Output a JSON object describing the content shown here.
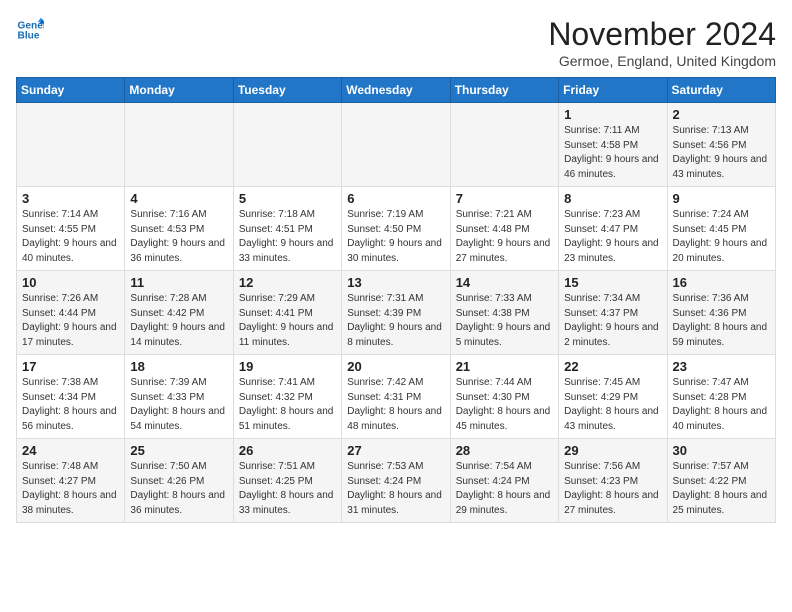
{
  "header": {
    "logo_line1": "General",
    "logo_line2": "Blue",
    "month_title": "November 2024",
    "location": "Germoe, England, United Kingdom"
  },
  "days_of_week": [
    "Sunday",
    "Monday",
    "Tuesday",
    "Wednesday",
    "Thursday",
    "Friday",
    "Saturday"
  ],
  "weeks": [
    [
      {
        "num": "",
        "info": ""
      },
      {
        "num": "",
        "info": ""
      },
      {
        "num": "",
        "info": ""
      },
      {
        "num": "",
        "info": ""
      },
      {
        "num": "",
        "info": ""
      },
      {
        "num": "1",
        "info": "Sunrise: 7:11 AM\nSunset: 4:58 PM\nDaylight: 9 hours and 46 minutes."
      },
      {
        "num": "2",
        "info": "Sunrise: 7:13 AM\nSunset: 4:56 PM\nDaylight: 9 hours and 43 minutes."
      }
    ],
    [
      {
        "num": "3",
        "info": "Sunrise: 7:14 AM\nSunset: 4:55 PM\nDaylight: 9 hours and 40 minutes."
      },
      {
        "num": "4",
        "info": "Sunrise: 7:16 AM\nSunset: 4:53 PM\nDaylight: 9 hours and 36 minutes."
      },
      {
        "num": "5",
        "info": "Sunrise: 7:18 AM\nSunset: 4:51 PM\nDaylight: 9 hours and 33 minutes."
      },
      {
        "num": "6",
        "info": "Sunrise: 7:19 AM\nSunset: 4:50 PM\nDaylight: 9 hours and 30 minutes."
      },
      {
        "num": "7",
        "info": "Sunrise: 7:21 AM\nSunset: 4:48 PM\nDaylight: 9 hours and 27 minutes."
      },
      {
        "num": "8",
        "info": "Sunrise: 7:23 AM\nSunset: 4:47 PM\nDaylight: 9 hours and 23 minutes."
      },
      {
        "num": "9",
        "info": "Sunrise: 7:24 AM\nSunset: 4:45 PM\nDaylight: 9 hours and 20 minutes."
      }
    ],
    [
      {
        "num": "10",
        "info": "Sunrise: 7:26 AM\nSunset: 4:44 PM\nDaylight: 9 hours and 17 minutes."
      },
      {
        "num": "11",
        "info": "Sunrise: 7:28 AM\nSunset: 4:42 PM\nDaylight: 9 hours and 14 minutes."
      },
      {
        "num": "12",
        "info": "Sunrise: 7:29 AM\nSunset: 4:41 PM\nDaylight: 9 hours and 11 minutes."
      },
      {
        "num": "13",
        "info": "Sunrise: 7:31 AM\nSunset: 4:39 PM\nDaylight: 9 hours and 8 minutes."
      },
      {
        "num": "14",
        "info": "Sunrise: 7:33 AM\nSunset: 4:38 PM\nDaylight: 9 hours and 5 minutes."
      },
      {
        "num": "15",
        "info": "Sunrise: 7:34 AM\nSunset: 4:37 PM\nDaylight: 9 hours and 2 minutes."
      },
      {
        "num": "16",
        "info": "Sunrise: 7:36 AM\nSunset: 4:36 PM\nDaylight: 8 hours and 59 minutes."
      }
    ],
    [
      {
        "num": "17",
        "info": "Sunrise: 7:38 AM\nSunset: 4:34 PM\nDaylight: 8 hours and 56 minutes."
      },
      {
        "num": "18",
        "info": "Sunrise: 7:39 AM\nSunset: 4:33 PM\nDaylight: 8 hours and 54 minutes."
      },
      {
        "num": "19",
        "info": "Sunrise: 7:41 AM\nSunset: 4:32 PM\nDaylight: 8 hours and 51 minutes."
      },
      {
        "num": "20",
        "info": "Sunrise: 7:42 AM\nSunset: 4:31 PM\nDaylight: 8 hours and 48 minutes."
      },
      {
        "num": "21",
        "info": "Sunrise: 7:44 AM\nSunset: 4:30 PM\nDaylight: 8 hours and 45 minutes."
      },
      {
        "num": "22",
        "info": "Sunrise: 7:45 AM\nSunset: 4:29 PM\nDaylight: 8 hours and 43 minutes."
      },
      {
        "num": "23",
        "info": "Sunrise: 7:47 AM\nSunset: 4:28 PM\nDaylight: 8 hours and 40 minutes."
      }
    ],
    [
      {
        "num": "24",
        "info": "Sunrise: 7:48 AM\nSunset: 4:27 PM\nDaylight: 8 hours and 38 minutes."
      },
      {
        "num": "25",
        "info": "Sunrise: 7:50 AM\nSunset: 4:26 PM\nDaylight: 8 hours and 36 minutes."
      },
      {
        "num": "26",
        "info": "Sunrise: 7:51 AM\nSunset: 4:25 PM\nDaylight: 8 hours and 33 minutes."
      },
      {
        "num": "27",
        "info": "Sunrise: 7:53 AM\nSunset: 4:24 PM\nDaylight: 8 hours and 31 minutes."
      },
      {
        "num": "28",
        "info": "Sunrise: 7:54 AM\nSunset: 4:24 PM\nDaylight: 8 hours and 29 minutes."
      },
      {
        "num": "29",
        "info": "Sunrise: 7:56 AM\nSunset: 4:23 PM\nDaylight: 8 hours and 27 minutes."
      },
      {
        "num": "30",
        "info": "Sunrise: 7:57 AM\nSunset: 4:22 PM\nDaylight: 8 hours and 25 minutes."
      }
    ]
  ]
}
